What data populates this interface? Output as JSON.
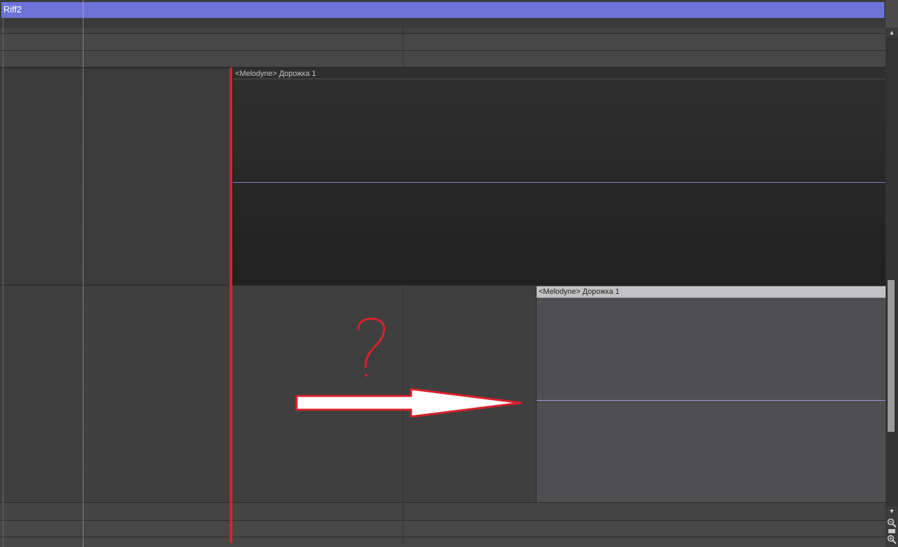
{
  "arranger": {
    "section_label": "Riff2",
    "section_color": "#6d73d6"
  },
  "clips": [
    {
      "title": "<Melodyne> Дорожка 1",
      "style": "dark"
    },
    {
      "title": "<Melodyne> Дорожка 1",
      "style": "light"
    }
  ],
  "annotations": {
    "question_mark_color": "#d8222b",
    "arrow_outline_color": "#d8222b",
    "arrow_fill_color": "#ffffff",
    "playhead_color": "#d8222b"
  },
  "scrollbar": {
    "up_icon": "arrow-up-icon",
    "down_icon": "arrow-down-icon",
    "zoom_out_icon": "zoom-out-icon",
    "zoom_in_icon": "zoom-in-icon"
  }
}
